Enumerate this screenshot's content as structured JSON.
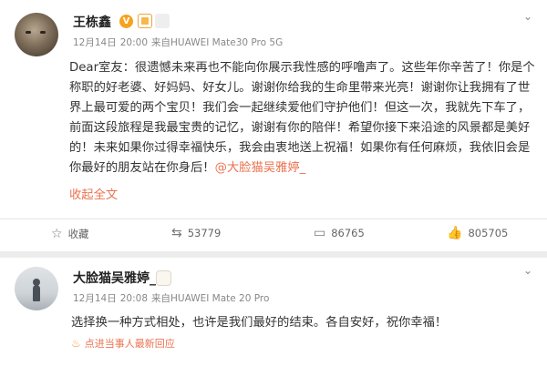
{
  "post": {
    "author": "王栋鑫",
    "badge": "V",
    "meta": {
      "date": "12月14日",
      "time": "20:00",
      "source_prefix": "来自",
      "device": "HUAWEI Mate30 Pro 5G"
    },
    "content_text": "Dear室友：很遗憾未来再也不能向你展示我性感的呼噜声了。这些年你辛苦了！你是个称职的好老婆、好妈妈、好女儿。谢谢你给我的生命里带来光亮！谢谢你让我拥有了世界上最可爱的两个宝贝！我们会一起继续爱他们守护他们！但这一次，我就先下车了，前面这段旅程是我最宝贵的记忆，谢谢有你的陪伴！希望你接下来沿途的风景都是美好的！未来如果你过得幸福快乐，我会由衷地送上祝福！如果你有任何麻烦，我依旧会是你最好的朋友站在你身后！",
    "mention": "@大脸猫吴雅婷_",
    "collapse_label": "收起全文",
    "actions": {
      "favorite_label": "收藏",
      "repost_count": "53779",
      "comment_count": "86765",
      "like_count": "805705"
    }
  },
  "comment": {
    "author": "大脸猫吴雅婷_",
    "meta": {
      "date": "12月14日",
      "time": "20:08",
      "source_prefix": "来自",
      "device": "HUAWEI Mate 20 Pro"
    },
    "text": "选择换一种方式相处，也许是我们最好的结束。各自安好，祝你幸福！",
    "sub_link": "点进当事人最新回应"
  },
  "icons": {
    "favorite": "star-icon",
    "repost": "repost-icon",
    "comment": "comment-icon",
    "like": "thumbs-up-icon",
    "menu": "chevron-down-icon",
    "hot": "fire-icon"
  },
  "colors": {
    "accent": "#eb7350",
    "verified": "#f7a21c",
    "background": "#ececec"
  }
}
